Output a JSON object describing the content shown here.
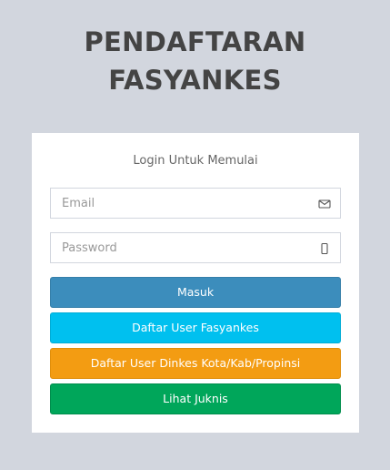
{
  "logo": {
    "line1": "PENDAFTARAN",
    "line2": "FASYANKES"
  },
  "login": {
    "message": "Login Untuk Memulai",
    "email_placeholder": "Email",
    "password_placeholder": "Password",
    "email_icon": "envelope-icon",
    "password_icon": "lock-icon"
  },
  "buttons": {
    "masuk": "Masuk",
    "daftar_fasyankes": "Daftar User Fasyankes",
    "daftar_dinkes": "Daftar User Dinkes Kota/Kab/Propinsi",
    "lihat_juknis": "Lihat Juknis"
  },
  "colors": {
    "background": "#d2d6de",
    "primary": "#3c8dbc",
    "info": "#00c0ef",
    "warning": "#f39c12",
    "success": "#00a65a"
  }
}
